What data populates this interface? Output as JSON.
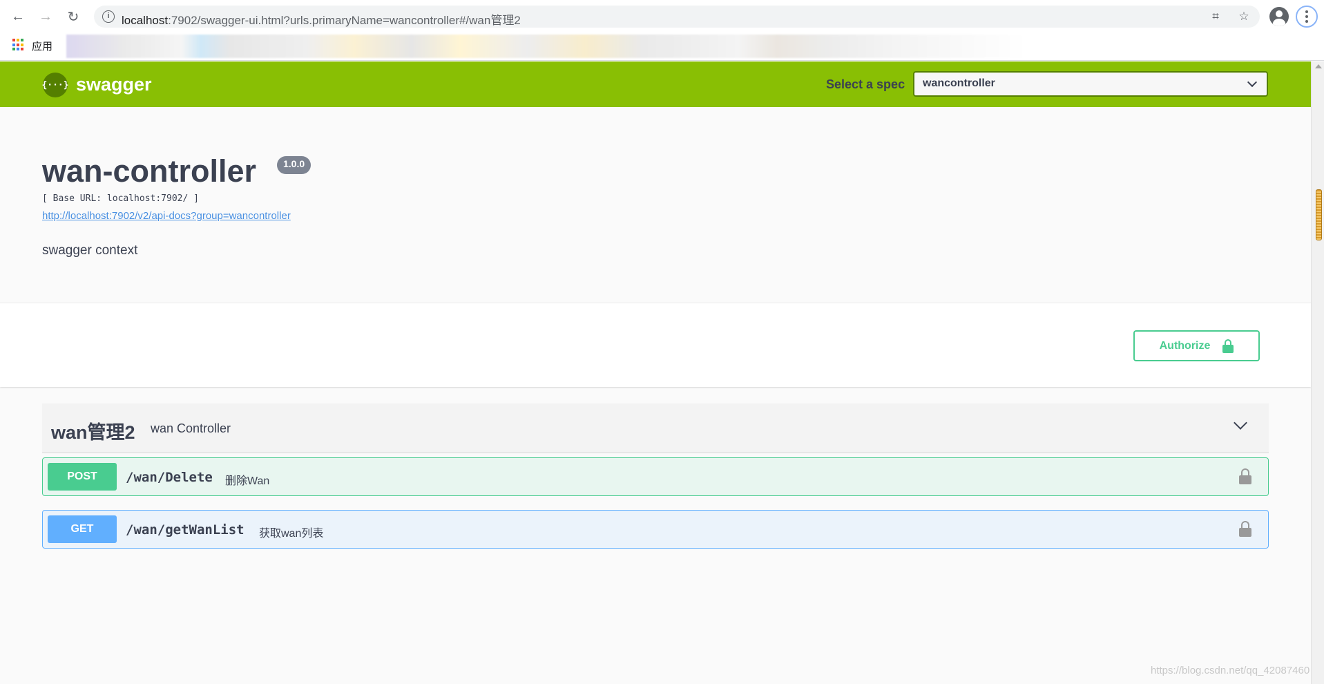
{
  "browser": {
    "url_host": "localhost",
    "url_rest": ":7902/swagger-ui.html?urls.primaryName=wancontroller#/wan管理2",
    "bookmarks_label": "应用",
    "info_glyph": "i",
    "back_glyph": "←",
    "forward_glyph": "→",
    "reload_glyph": "↻",
    "translate_glyph": "⌗",
    "star_glyph": "☆"
  },
  "topbar": {
    "logo_glyph": "{···}",
    "logo_text": "swagger",
    "spec_label": "Select a spec",
    "spec_value": "wancontroller"
  },
  "info": {
    "title": "wan-controller",
    "version": "1.0.0",
    "base_url": "[ Base URL: localhost:7902/ ]",
    "api_docs_link": "http://localhost:7902/v2/api-docs?group=wancontroller",
    "description": "swagger context"
  },
  "auth": {
    "button_label": "Authorize"
  },
  "tag": {
    "name": "wan管理2",
    "description": "wan Controller"
  },
  "operations": [
    {
      "method": "POST",
      "path": "/wan/Delete",
      "summary": "删除Wan"
    },
    {
      "method": "GET",
      "path": "/wan/getWanList",
      "summary": "获取wan列表"
    }
  ],
  "watermark": "https://blog.csdn.net/qq_42087460",
  "colors": {
    "topbar": "#89bf04",
    "post": "#49cc90",
    "get": "#61affe",
    "text": "#3b4151",
    "link": "#4990e2"
  }
}
